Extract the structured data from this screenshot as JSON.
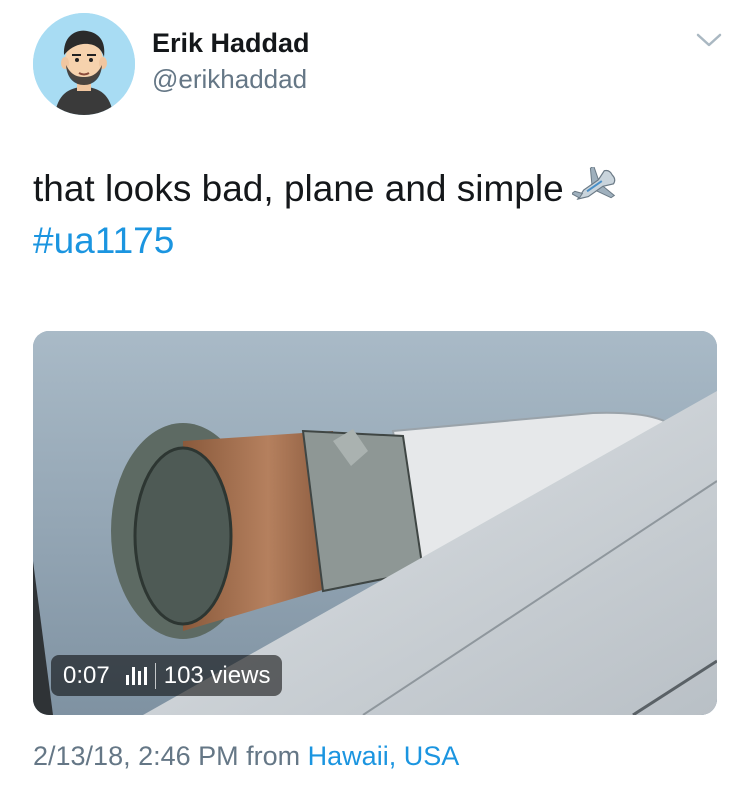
{
  "user": {
    "name": "Erik Haddad",
    "handle": "@erikhaddad"
  },
  "tweet": {
    "text": "that looks bad, plane and simple",
    "hashtag": "#ua1175",
    "emoji_icon": "airplane-icon"
  },
  "media": {
    "time": "0:07",
    "views": "103 views"
  },
  "meta": {
    "timestamp": "2/13/18, 2:46 PM",
    "from_label": "from",
    "location": "Hawaii, USA"
  },
  "colors": {
    "link": "#1b95e0",
    "secondary": "#657786",
    "avatar_bg": "#a8dcf3"
  }
}
